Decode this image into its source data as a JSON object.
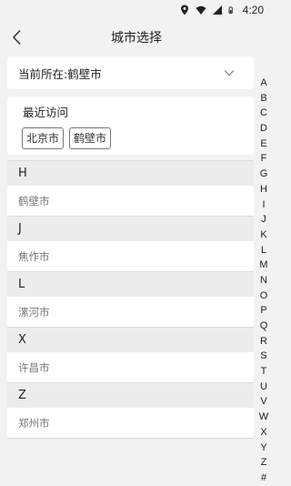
{
  "status_bar": {
    "time": "4:20"
  },
  "header": {
    "title": "城市选择"
  },
  "current_location": {
    "label": "当前所在:鹤壁市"
  },
  "recent": {
    "label": "最近访问",
    "cities": [
      "北京市",
      "鹤壁市"
    ]
  },
  "groups": [
    {
      "letter": "H",
      "cities": [
        "鹤壁市"
      ]
    },
    {
      "letter": "J",
      "cities": [
        "焦作市"
      ]
    },
    {
      "letter": "L",
      "cities": [
        "漯河市"
      ]
    },
    {
      "letter": "X",
      "cities": [
        "许昌市"
      ]
    },
    {
      "letter": "Z",
      "cities": [
        "郑州市"
      ]
    }
  ],
  "index_letters": [
    "A",
    "B",
    "C",
    "D",
    "E",
    "F",
    "G",
    "H",
    "I",
    "J",
    "K",
    "L",
    "M",
    "N",
    "O",
    "P",
    "Q",
    "R",
    "S",
    "T",
    "U",
    "V",
    "W",
    "X",
    "Y",
    "Z",
    "#"
  ]
}
